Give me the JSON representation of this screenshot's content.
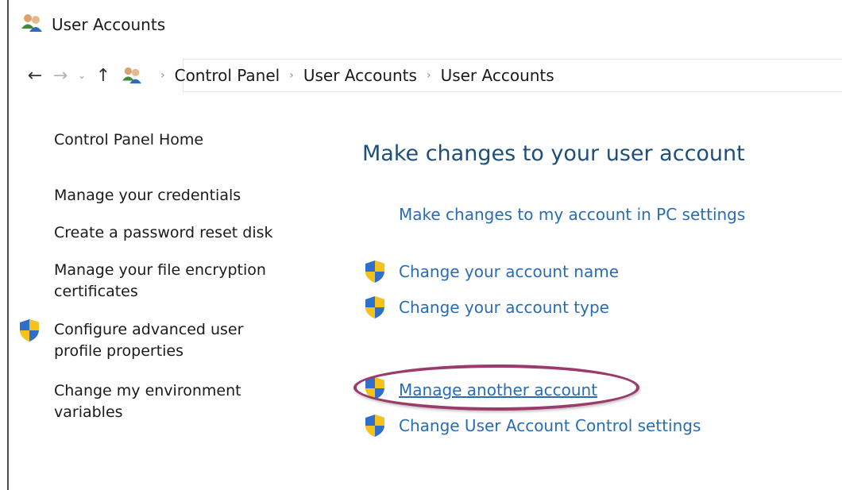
{
  "window": {
    "title": "User Accounts"
  },
  "nav": {
    "breadcrumbs": [
      "Control Panel",
      "User Accounts",
      "User Accounts"
    ]
  },
  "sidebar": {
    "items": [
      {
        "label": "Control Panel Home"
      },
      {
        "label": "Manage your credentials"
      },
      {
        "label": "Create a password reset disk"
      },
      {
        "label_line1": "Manage your file encryption",
        "label_line2": "certificates"
      },
      {
        "label_line1": "Configure advanced user",
        "label_line2": "profile properties",
        "icon": "uac-shield-icon"
      },
      {
        "label_line1": "Change my environment",
        "label_line2": "variables"
      }
    ]
  },
  "main": {
    "heading": "Make changes to your user account",
    "links": [
      {
        "label": "Make changes to my account in PC settings"
      },
      {
        "label": "Change your account name",
        "icon": "uac-shield-icon"
      },
      {
        "label": "Change your account type",
        "icon": "uac-shield-icon"
      },
      {
        "label": "Manage another account",
        "icon": "uac-shield-icon",
        "highlighted": true
      },
      {
        "label": "Change User Account Control settings",
        "icon": "uac-shield-icon"
      }
    ]
  },
  "colors": {
    "link": "#2a6cb3",
    "heading": "#1e4e79",
    "highlight_ellipse": "#9b3b6b"
  }
}
